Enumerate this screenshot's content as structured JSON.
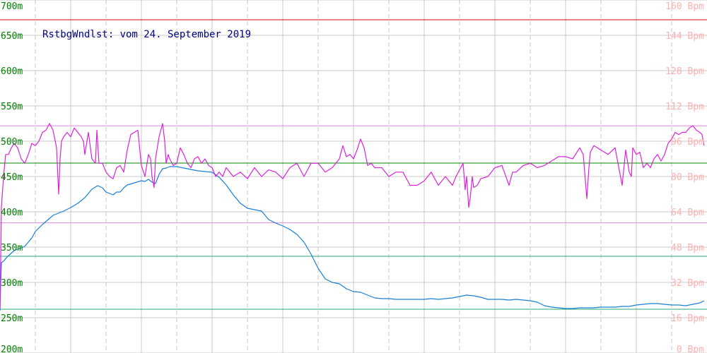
{
  "chart_data": {
    "type": "line",
    "title": "RstbgWndlst: vom 24. September 2019",
    "xlabel": "",
    "ylabel": "",
    "grid": true,
    "colors": {
      "elevation": "#1a7fd6",
      "heart_rate": "#dd22dd",
      "max_line": "#dd0000",
      "hr_band": "#e08ae0",
      "elev_band": "#2aa87a",
      "avg_line": "#008800",
      "grid_solid": "#c8c8c8",
      "grid_dashed": "#c8c8c8"
    },
    "y_left": {
      "min": 200,
      "max": 700,
      "ticks": [
        "200m",
        "250m",
        "300m",
        "350m",
        "400m",
        "450m",
        "500m",
        "550m",
        "600m",
        "650m",
        "700m"
      ]
    },
    "y_right": {
      "min": 0,
      "max": 160,
      "ticks": [
        "0 Bpm",
        "16 Bpm",
        "32 Bpm",
        "48 Bpm",
        "64 Bpm",
        "80 Bpm",
        "96 Bpm",
        "112 Bpm",
        "128 Bpm",
        "144 Bpm",
        "160 Bpm"
      ]
    },
    "reference_lines": {
      "max_line_m": 672,
      "hr_band_bpm": [
        103,
        59
      ],
      "elev_band_m": [
        337,
        262
      ],
      "avg_line_m": 469
    },
    "series": [
      {
        "key": "elevation",
        "axis": "left",
        "x": [
          0,
          1,
          2,
          5,
          10,
          20,
          35,
          45,
          50,
          60,
          75,
          90,
          100,
          110,
          120,
          130,
          138,
          145,
          150,
          155,
          160,
          165,
          170,
          175,
          180,
          190,
          200,
          205,
          210,
          215,
          220,
          225,
          230,
          235,
          240,
          250,
          260,
          270,
          280,
          290,
          300,
          310,
          320,
          330,
          340,
          350,
          360,
          370,
          380,
          390,
          400,
          410,
          420,
          430,
          440,
          450,
          460,
          470,
          480,
          490,
          500,
          510,
          520,
          530,
          540,
          550,
          560,
          570,
          580,
          590,
          600,
          610,
          620,
          630,
          640,
          650,
          660,
          670,
          680,
          690,
          700,
          710,
          720,
          730,
          740,
          750,
          760,
          770,
          780,
          790,
          800,
          810,
          820,
          830,
          840,
          850,
          860,
          870,
          880,
          890,
          900,
          910,
          920,
          930,
          940,
          950,
          960,
          970,
          980,
          990,
          996
        ],
        "y": [
          260,
          300,
          328,
          330,
          336,
          345,
          351,
          363,
          372,
          382,
          395,
          401,
          406,
          412,
          420,
          432,
          437,
          434,
          428,
          426,
          424,
          428,
          428,
          434,
          438,
          441,
          444,
          443,
          446,
          442,
          440,
          453,
          461,
          462,
          464,
          464,
          462,
          460,
          458,
          457,
          456,
          449,
          438,
          424,
          412,
          405,
          403,
          401,
          389,
          384,
          380,
          375,
          368,
          357,
          340,
          320,
          305,
          300,
          298,
          291,
          287,
          286,
          282,
          278,
          277,
          277,
          276,
          276,
          276,
          276,
          276,
          277,
          276,
          277,
          278,
          280,
          282,
          281,
          279,
          276,
          276,
          276,
          275,
          276,
          275,
          274,
          272,
          267,
          265,
          264,
          263,
          263,
          264,
          264,
          264,
          265,
          265,
          265,
          266,
          266,
          268,
          269,
          270,
          270,
          269,
          268,
          268,
          267,
          269,
          271,
          274
        ]
      },
      {
        "key": "heart_rate",
        "axis": "right",
        "x": [
          0,
          2,
          5,
          8,
          12,
          16,
          20,
          25,
          30,
          35,
          40,
          45,
          50,
          55,
          60,
          65,
          70,
          75,
          80,
          83,
          85,
          87,
          90,
          95,
          100,
          105,
          110,
          115,
          118,
          120,
          125,
          130,
          135,
          137,
          140,
          145,
          150,
          155,
          160,
          165,
          170,
          175,
          180,
          185,
          190,
          195,
          200,
          205,
          210,
          213,
          215,
          218,
          220,
          225,
          230,
          233,
          235,
          238,
          240,
          245,
          250,
          255,
          260,
          265,
          270,
          275,
          280,
          285,
          290,
          295,
          300,
          305,
          310,
          315,
          320,
          330,
          340,
          350,
          360,
          370,
          380,
          390,
          400,
          410,
          420,
          430,
          440,
          450,
          460,
          470,
          480,
          485,
          490,
          495,
          500,
          505,
          510,
          515,
          520,
          525,
          530,
          540,
          550,
          560,
          570,
          580,
          590,
          600,
          610,
          620,
          630,
          640,
          645,
          650,
          655,
          658,
          660,
          663,
          665,
          668,
          670,
          675,
          680,
          690,
          700,
          710,
          720,
          725,
          730,
          740,
          750,
          760,
          770,
          780,
          790,
          800,
          810,
          820,
          825,
          830,
          833,
          835,
          840,
          850,
          860,
          870,
          880,
          885,
          890,
          893,
          895,
          900,
          905,
          910,
          915,
          920,
          925,
          930,
          935,
          940,
          945,
          950,
          955,
          960,
          965,
          970,
          975,
          980,
          985,
          990,
          993,
          996
        ],
        "y": [
          20,
          66,
          80,
          90,
          90,
          93,
          95,
          93,
          88,
          86,
          90,
          95,
          94,
          96,
          100,
          101,
          104,
          101,
          93,
          72,
          88,
          96,
          98,
          100,
          98,
          102,
          100,
          98,
          96,
          90,
          100,
          88,
          86,
          101,
          86,
          86,
          82,
          80,
          79,
          84,
          85,
          82,
          92,
          99,
          100,
          101,
          85,
          80,
          90,
          88,
          80,
          75,
          88,
          98,
          104,
          96,
          86,
          90,
          88,
          85,
          86,
          93,
          90,
          86,
          84,
          88,
          89,
          86,
          88,
          85,
          84,
          80,
          82,
          80,
          84,
          80,
          82,
          79,
          84,
          80,
          83,
          82,
          79,
          84,
          86,
          80,
          86,
          86,
          82,
          84,
          88,
          94,
          89,
          90,
          88,
          92,
          97,
          93,
          85,
          86,
          84,
          84,
          80,
          82,
          82,
          76,
          76,
          78,
          82,
          76,
          80,
          76,
          80,
          83,
          86,
          74,
          80,
          66,
          70,
          80,
          75,
          76,
          79,
          80,
          84,
          85,
          76,
          82,
          82,
          85,
          86,
          84,
          85,
          87,
          89,
          89,
          88,
          93,
          90,
          70,
          84,
          91,
          94,
          92,
          90,
          93,
          76,
          92,
          82,
          80,
          93,
          90,
          91,
          84,
          86,
          84,
          88,
          90,
          87,
          90,
          95,
          97,
          100,
          99,
          100,
          100,
          102,
          103,
          101,
          100,
          99,
          94
        ]
      }
    ]
  }
}
